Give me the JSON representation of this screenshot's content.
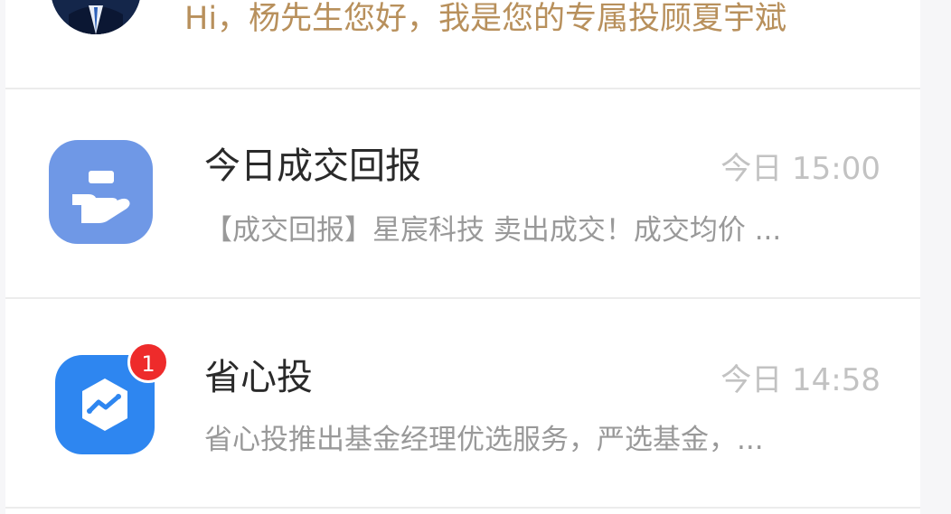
{
  "greeting": {
    "text": "Hi，杨先生您好，我是您的专属投顾夏宇斌"
  },
  "messages": [
    {
      "title": "今日成交回报",
      "time": "今日 15:00",
      "preview": "【成交回报】星宸科技 卖出成交！成交均价 ...",
      "icon": "hand-card-icon",
      "icon_color": "#6f98e6"
    },
    {
      "title": "省心投",
      "time": "今日 14:58",
      "preview": "省心投推出基金经理优选服务，严选基金，...",
      "icon": "hexagon-chart-icon",
      "icon_color": "#2e86f0",
      "badge": "1",
      "badge_color": "#ee2b2b"
    }
  ],
  "colors": {
    "greeting": "#b8905c",
    "divider": "#ececec"
  }
}
